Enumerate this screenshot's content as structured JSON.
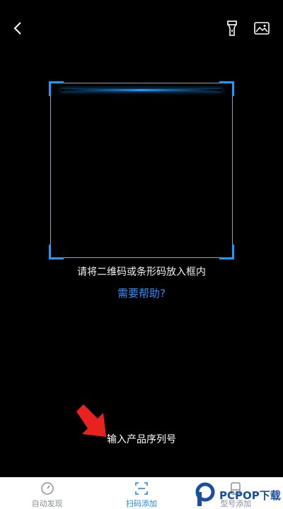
{
  "topbar": {
    "back_icon": "chevron-left-icon",
    "flashlight_icon": "flashlight-icon",
    "album_icon": "image-album-icon"
  },
  "scanner": {
    "hint": "请将二维码或条形码放入框内",
    "help_link": "需要帮助?",
    "accent_color": "#1e9bff"
  },
  "manual_entry": {
    "label": "输入产品序列号"
  },
  "tabs": [
    {
      "label": "自动发现",
      "icon": "gauge-icon",
      "active": false
    },
    {
      "label": "扫码添加",
      "icon": "scan-icon",
      "active": true
    },
    {
      "label": "型号添加",
      "icon": "device-icon",
      "active": false
    }
  ],
  "watermark": {
    "text": "PCPOP下载"
  }
}
